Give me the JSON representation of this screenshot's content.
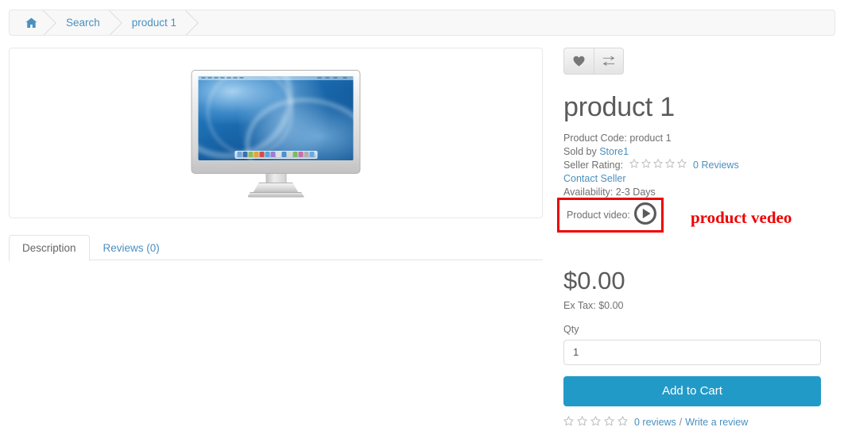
{
  "breadcrumb": {
    "items": [
      {
        "label": "",
        "icon": "home-icon",
        "name": "breadcrumb-home"
      },
      {
        "label": "Search",
        "icon": "",
        "name": "breadcrumb-search"
      },
      {
        "label": "product 1",
        "icon": "",
        "name": "breadcrumb-product"
      }
    ]
  },
  "gallery": {
    "image_alt": "Apple Cinema Display monitor",
    "icon": "monitor-image"
  },
  "tabs": [
    {
      "label": "Description",
      "active": true
    },
    {
      "label": "Reviews (0)",
      "active": false
    }
  ],
  "tab_content": "",
  "actions": {
    "wishlist_icon": "heart-icon",
    "compare_icon": "exchange-icon"
  },
  "product": {
    "title": "product 1",
    "code_label": "Product Code:",
    "code_value": "product 1",
    "sold_by_label": "Sold by",
    "sold_by_value": "Store1",
    "seller_rating_label": "Seller Rating:",
    "seller_reviews": "0 Reviews",
    "seller_rating_stars": 0,
    "contact_seller": "Contact Seller",
    "availability_label": "Availability:",
    "availability_value": "2-3 Days",
    "availability_line": "Availability: 2-3 Days",
    "video_label": "Product video:",
    "video_play_icon": "play-circle-icon",
    "price": "$0.00",
    "ex_tax": "Ex Tax: $0.00",
    "qty_label": "Qty",
    "qty_value": "1",
    "add_to_cart": "Add to Cart",
    "reviews_count_link": "0 reviews",
    "reviews_separator": "/",
    "write_review_link": "Write a review",
    "product_rating_stars": 0
  },
  "annotation": {
    "text": "product vedeo",
    "color": "#ee0000"
  },
  "colors": {
    "accent_blue": "#229ac8",
    "link_blue": "#4a90bf",
    "annotation_red": "#ee0000",
    "text_gray": "#6f6f6f",
    "heading_gray": "#5b5b5b",
    "panel_border": "#e8e8e8",
    "breadcrumb_bg": "#f8f8f8"
  }
}
